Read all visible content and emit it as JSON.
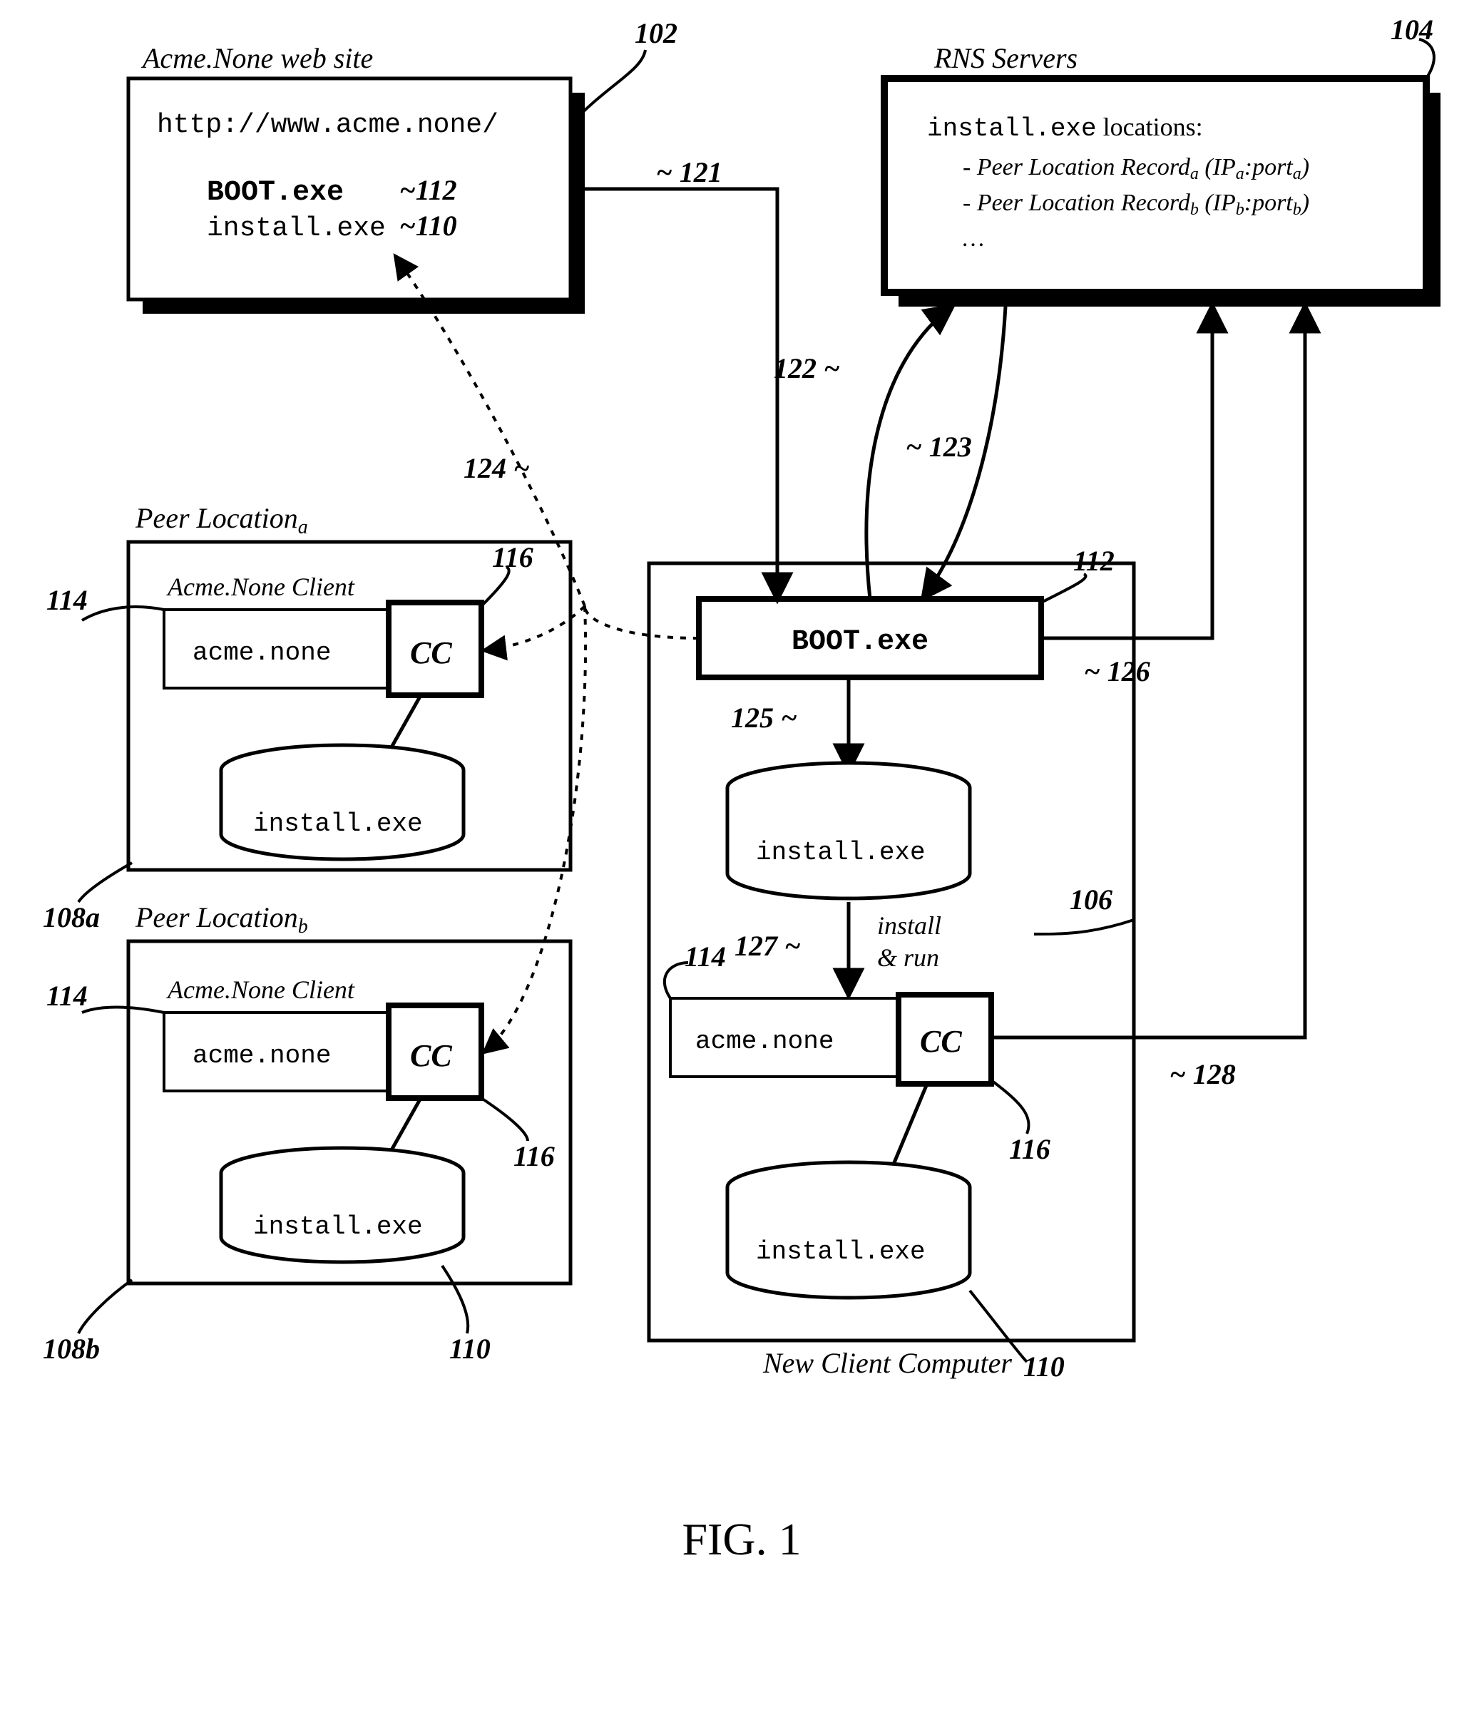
{
  "figure_label": "FIG. 1",
  "website": {
    "title": "Acme.None web site",
    "url": "http://www.acme.none/",
    "boot_exe": "BOOT.exe",
    "install_exe": "install.exe",
    "ref": "102",
    "ref_boot": "~112",
    "ref_install": "~110"
  },
  "rns": {
    "title": "RNS Servers",
    "heading_pre": "install.exe",
    "heading_post": " locations:",
    "line_a_pre": "- Peer Location Record",
    "line_a_sub": "a",
    "line_a_paren": " (IP",
    "line_a_sub2": "a",
    "line_a_mid": ":port",
    "line_a_sub3": "a",
    "line_a_end": ")",
    "line_b_pre": "- Peer Location Record",
    "line_b_sub": "b",
    "line_b_paren": " (IP",
    "line_b_sub2": "b",
    "line_b_mid": ":port",
    "line_b_sub3": "b",
    "line_b_end": ")",
    "ellipsis": "…",
    "ref": "104"
  },
  "peer_a": {
    "title_pre": "Peer Location",
    "title_sub": "a",
    "client_label": "Acme.None Client",
    "acme_none": "acme.none",
    "cc": "CC",
    "install_exe": "install.exe",
    "ref_box": "108a",
    "ref_client": "114",
    "ref_cc": "116"
  },
  "peer_b": {
    "title_pre": "Peer Location",
    "title_sub": "b",
    "client_label": "Acme.None Client",
    "acme_none": "acme.none",
    "cc": "CC",
    "install_exe": "install.exe",
    "ref_box": "108b",
    "ref_client": "114",
    "ref_cc": "116",
    "ref_install": "110"
  },
  "newclient": {
    "title": "New Client Computer",
    "boot_exe": "BOOT.exe",
    "install_exe_top": "install.exe",
    "install_run": "install & run",
    "acme_none": "acme.none",
    "cc": "CC",
    "install_exe_bottom": "install.exe",
    "ref_box": "106",
    "ref_boot": "112",
    "ref_client": "114",
    "ref_cc": "116",
    "ref_install_bottom": "110"
  },
  "arrows": {
    "r121": "~ 121",
    "r122": "122 ~",
    "r123": "~ 123",
    "r124": "124 ~",
    "r125": "125 ~",
    "r126": "~ 126",
    "r127": "127 ~",
    "r128": "~ 128"
  }
}
